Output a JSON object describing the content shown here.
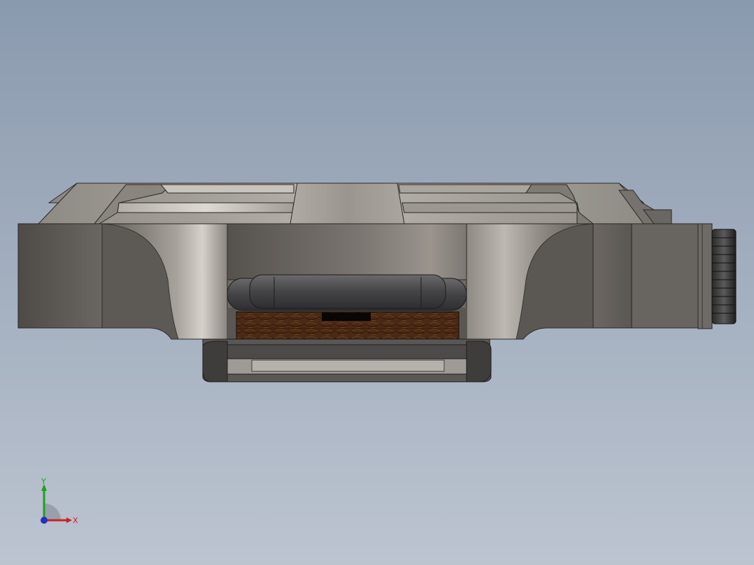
{
  "viewport": {
    "background_top": "#8a9aae",
    "background_bottom": "#bcc4d0"
  },
  "model": {
    "wood_color": "#4a2a14",
    "body_color": "#6a6660"
  },
  "triad": {
    "x_label": "X",
    "y_label": "Y",
    "x_color": "#d02020",
    "y_color": "#20a020",
    "z_color": "#2030c0"
  }
}
